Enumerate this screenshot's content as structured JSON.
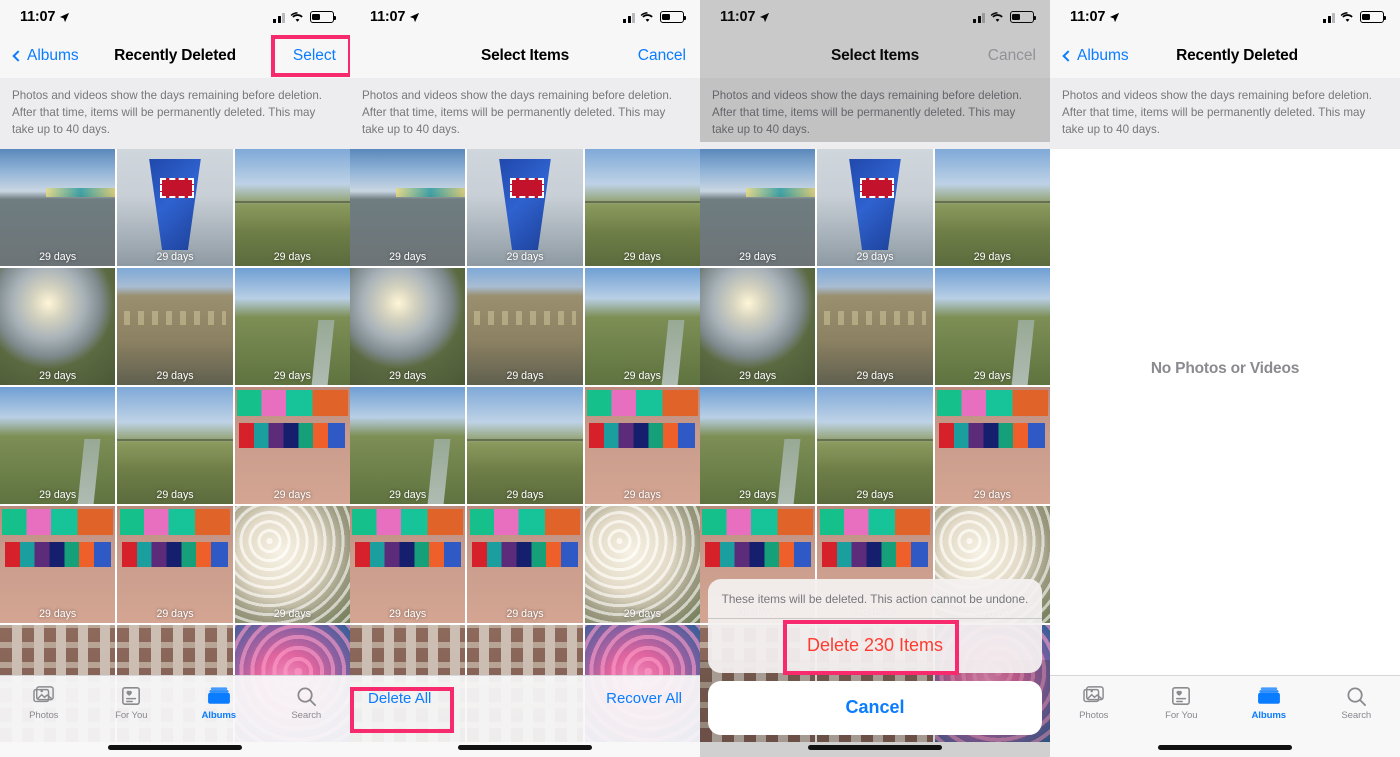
{
  "status_bar": {
    "time": "11:07",
    "location_icon": "location-arrow-icon",
    "signal_icon": "cellular-signal-icon",
    "wifi_icon": "wifi-icon",
    "battery_icon": "battery-icon"
  },
  "description": "Photos and videos show the days remaining before deletion. After that time, items will be permanently deleted. This may take up to 40 days.",
  "day_label": "29 days",
  "colors": {
    "accent_blue": "#0a7cff",
    "highlight_pink": "#f72a6d",
    "destructive_red": "#ff3b30",
    "muted_gray": "#8a8a8f"
  },
  "tab_bar": {
    "items": [
      {
        "label": "Photos",
        "icon": "photos-icon",
        "active": false
      },
      {
        "label": "For You",
        "icon": "for-you-icon",
        "active": false
      },
      {
        "label": "Albums",
        "icon": "albums-icon",
        "active": true
      },
      {
        "label": "Search",
        "icon": "search-icon",
        "active": false
      }
    ]
  },
  "panels": [
    {
      "id": "panel-1-recently-deleted",
      "nav": {
        "back_label": "Albums",
        "title": "Recently Deleted",
        "action_label": "Select",
        "action_highlighted": true
      }
    },
    {
      "id": "panel-2-select-items",
      "nav": {
        "title": "Select Items",
        "action_label": "Cancel",
        "action_disabled": false
      },
      "toolbar": {
        "delete_all_label": "Delete All",
        "delete_all_highlighted": true,
        "recover_all_label": "Recover All"
      }
    },
    {
      "id": "panel-3-confirm-delete",
      "nav": {
        "title": "Select Items",
        "action_label": "Cancel",
        "action_disabled": true
      },
      "action_sheet": {
        "message": "These items will be deleted. This action cannot be undone.",
        "destructive_label": "Delete 230 Items",
        "destructive_highlighted": true,
        "cancel_label": "Cancel"
      }
    },
    {
      "id": "panel-4-empty",
      "nav": {
        "back_label": "Albums",
        "title": "Recently Deleted"
      },
      "empty_state": "No Photos or Videos"
    }
  ],
  "photo_grid": {
    "rows": 5,
    "columns": 3,
    "thumbnails": [
      {
        "art": "ph-river",
        "days": "29 days"
      },
      {
        "art": "ph-crane",
        "days": "29 days"
      },
      {
        "art": "ph-field",
        "days": "29 days"
      },
      {
        "art": "ph-sun",
        "days": "29 days"
      },
      {
        "art": "ph-wall",
        "days": "29 days"
      },
      {
        "art": "ph-path",
        "days": "29 days"
      },
      {
        "art": "ph-path",
        "days": "29 days"
      },
      {
        "art": "ph-field",
        "days": "29 days"
      },
      {
        "art": "ph-color",
        "days": "29 days"
      },
      {
        "art": "ph-color",
        "days": "29 days"
      },
      {
        "art": "ph-color",
        "days": "29 days"
      },
      {
        "art": "ph-blossom",
        "days": "29 days"
      },
      {
        "art": "ph-build",
        "days": ""
      },
      {
        "art": "ph-build",
        "days": ""
      },
      {
        "art": "ph-pink",
        "days": ""
      }
    ]
  }
}
